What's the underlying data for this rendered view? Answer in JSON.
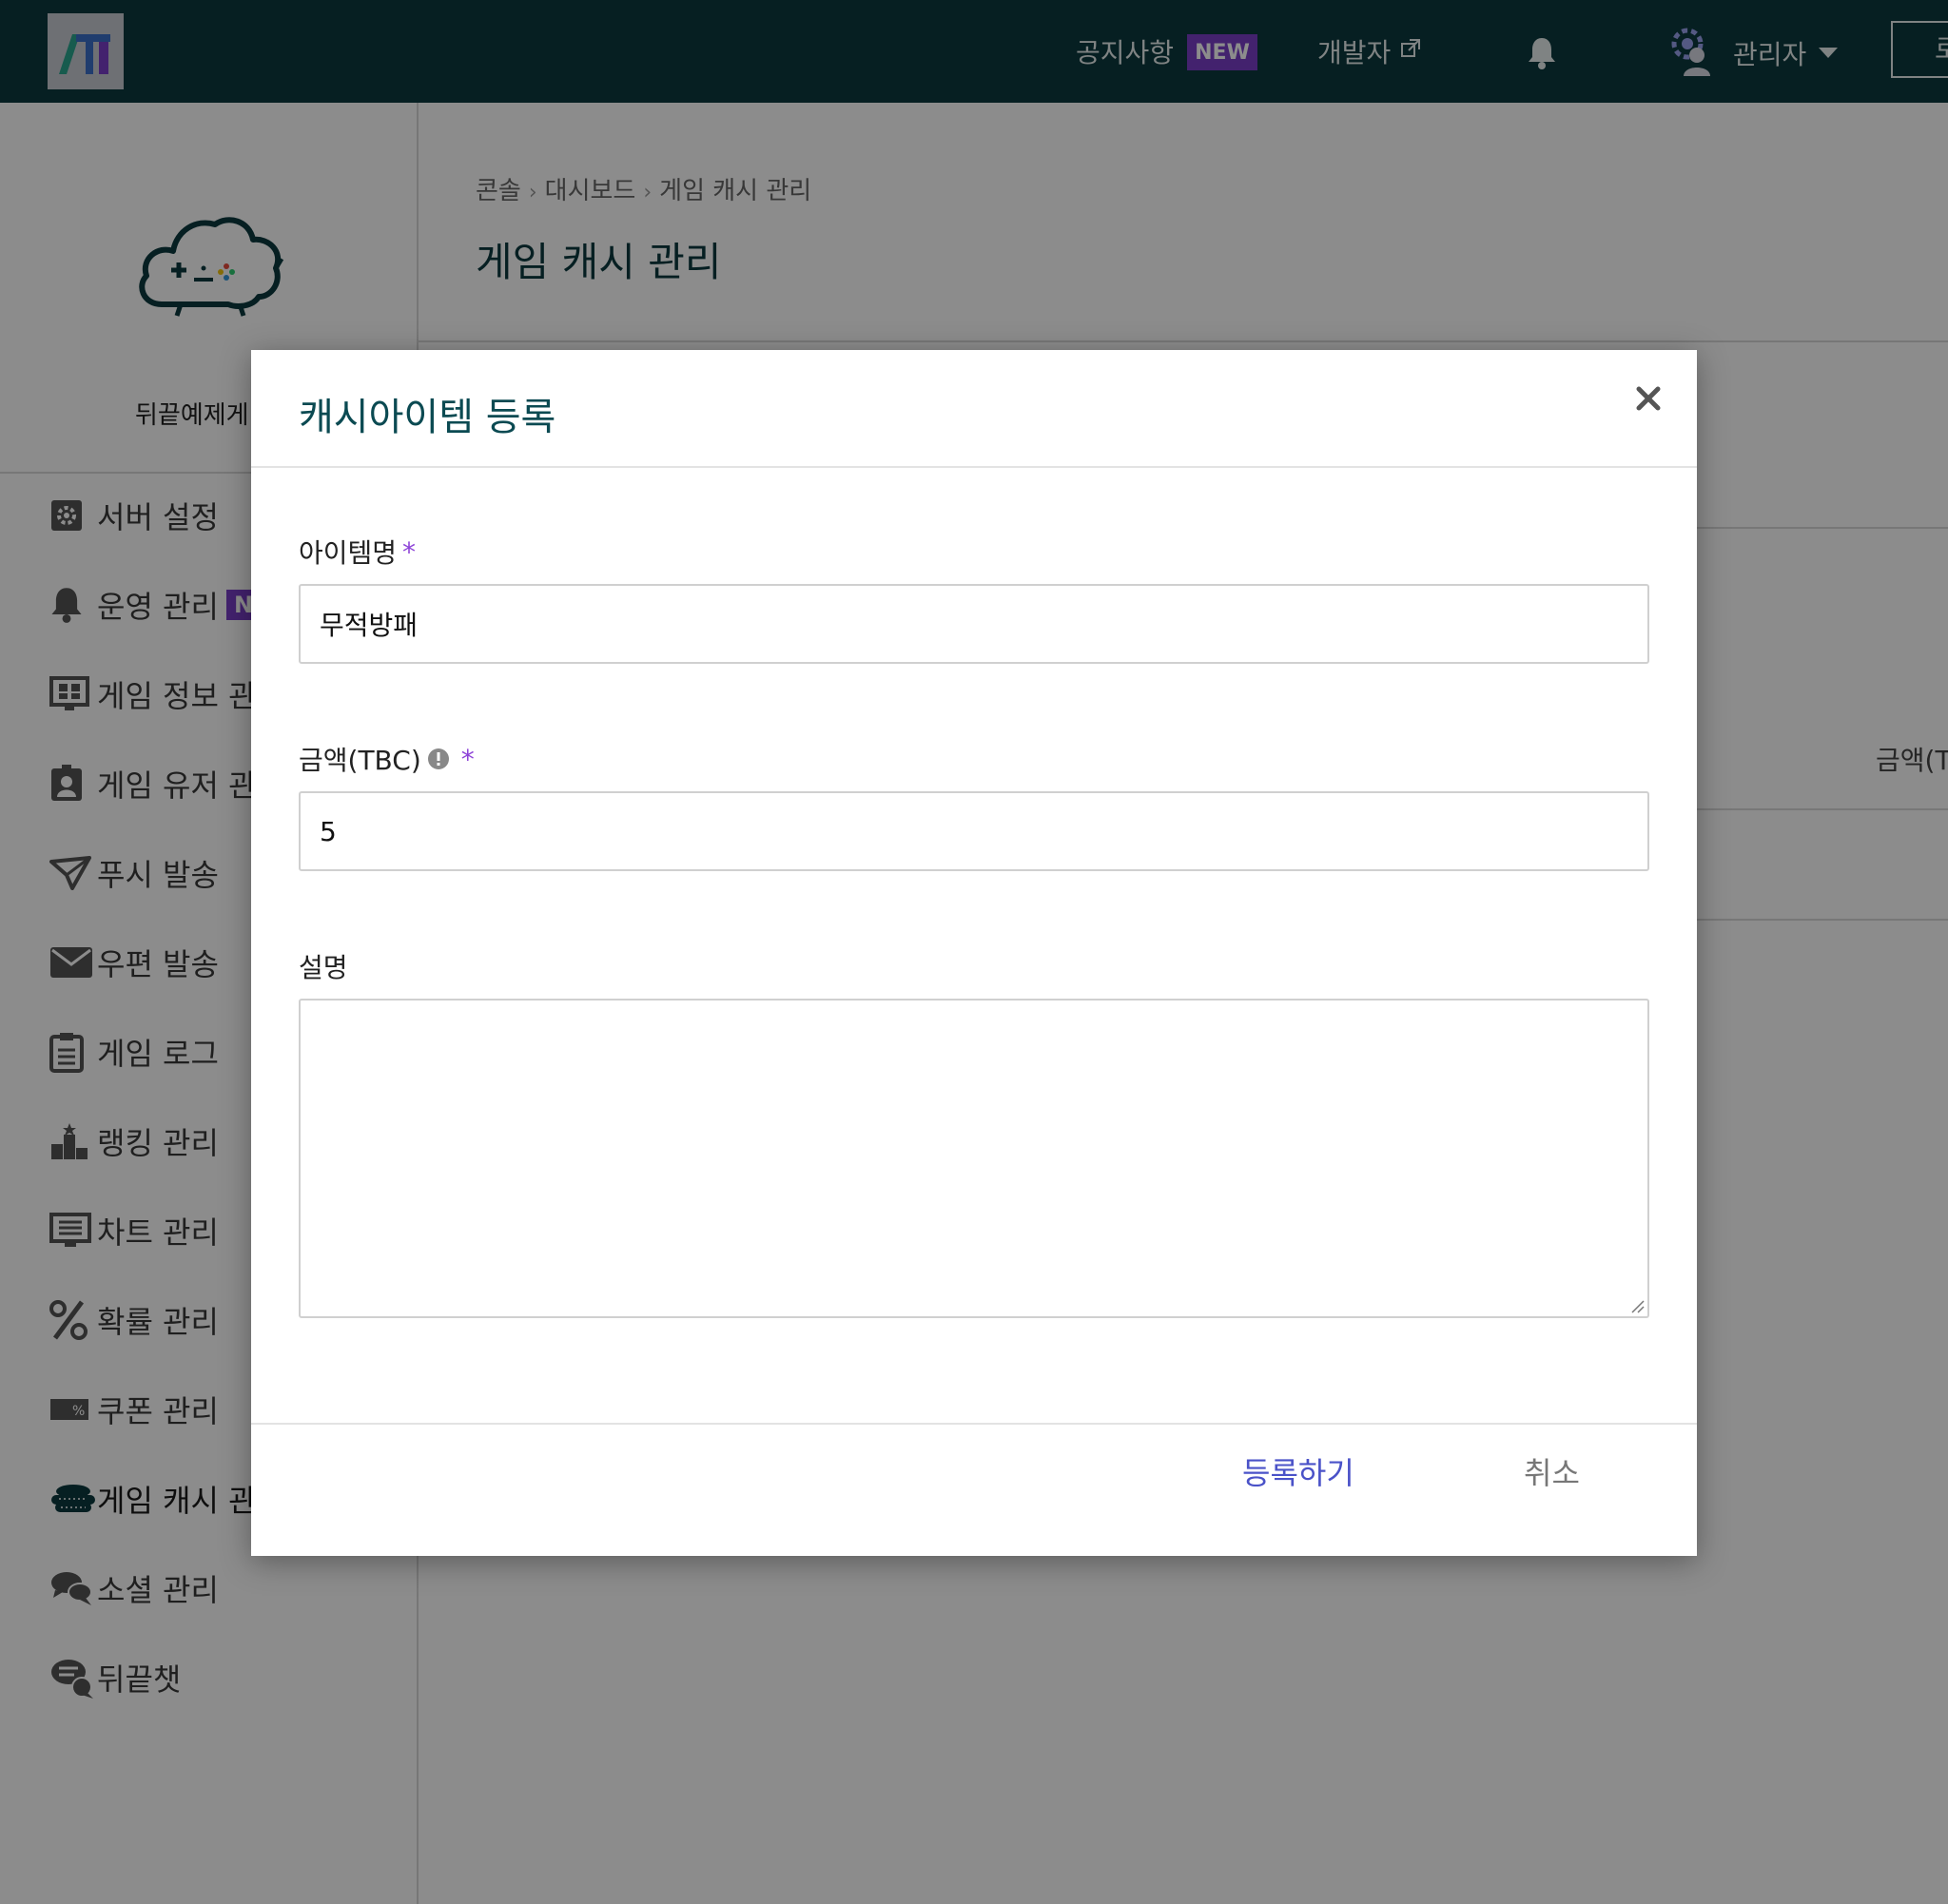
{
  "topbar": {
    "notice_label": "공지사항",
    "notice_badge": "NEW",
    "developer_label": "개발자",
    "admin_label": "관리자",
    "right_button_label": "로"
  },
  "sidebar": {
    "project_name": "뒤끝예제게",
    "items": [
      {
        "label": "서버 설정",
        "icon": "gear-square-icon"
      },
      {
        "label": "운영 관리",
        "icon": "bell-icon",
        "badge": "N"
      },
      {
        "label": "게임 정보 관",
        "icon": "grid-monitor-icon"
      },
      {
        "label": "게임 유저 관",
        "icon": "user-badge-icon"
      },
      {
        "label": "푸시 발송",
        "icon": "paper-plane-icon"
      },
      {
        "label": "우편 발송",
        "icon": "envelope-icon"
      },
      {
        "label": "게임 로그",
        "icon": "clipboard-icon"
      },
      {
        "label": "랭킹 관리",
        "icon": "podium-icon"
      },
      {
        "label": "차트 관리",
        "icon": "monitor-icon"
      },
      {
        "label": "확률 관리",
        "icon": "percent-icon"
      },
      {
        "label": "쿠폰 관리",
        "icon": "coupon-icon"
      },
      {
        "label": "게임 캐시 관",
        "icon": "coins-icon"
      },
      {
        "label": "소셜 관리",
        "icon": "chat-bubbles-icon"
      },
      {
        "label": "뒤끝챗",
        "icon": "chat-icon"
      }
    ]
  },
  "main": {
    "breadcrumb": [
      "콘솔",
      "대시보드",
      "게임 캐시 관리"
    ],
    "title": "게임 캐시 관리",
    "column_header": "금액(T"
  },
  "modal": {
    "title": "캐시아이템 등록",
    "item_name_label": "아이템명",
    "item_name_value": "무적방패",
    "amount_label": "금액(TBC)",
    "amount_value": "5",
    "description_label": "설명",
    "description_value": "",
    "required_mark": "*",
    "register_label": "등록하기",
    "cancel_label": "취소"
  },
  "colors": {
    "topbar_bg": "#0b3a3f",
    "badge_purple": "#7b3fc9",
    "primary_text": "#0b4a52",
    "register_button": "#4a52c8"
  }
}
